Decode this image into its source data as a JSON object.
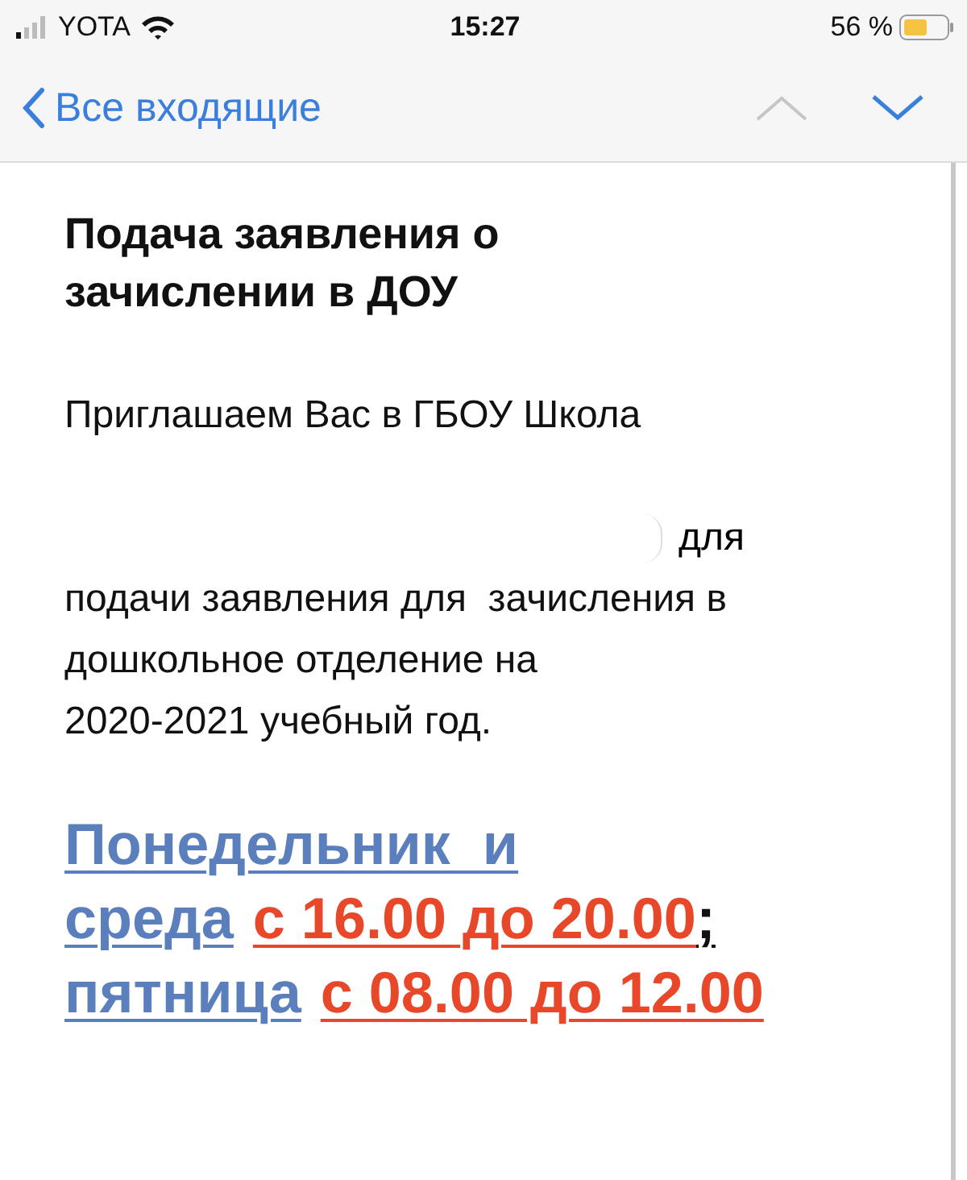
{
  "status_bar": {
    "carrier": "YOTA",
    "time": "15:27",
    "battery": "56 %"
  },
  "nav": {
    "back": "Все входящие"
  },
  "message": {
    "title": "Подача заявления о зачислении в ДОУ",
    "intro": "Приглашаем Вас в ГБОУ Школа",
    "after_redacted": "для",
    "body_lines": [
      "подачи заявления для  зачисления в",
      "дошкольное отделение на",
      "2020-2021 учебный год."
    ],
    "schedule_lines": [
      [
        {
          "text": "Понедельник  и",
          "color": "#5b7fbd"
        }
      ],
      [
        {
          "text": "среда",
          "color": "#5b7fbd"
        },
        {
          "text": "с 16.00 до 20.00",
          "color": "#e8472a"
        },
        {
          "text": ";",
          "color": "#111111",
          "kind": "punctuation"
        }
      ],
      [
        {
          "text": "пятница",
          "color": "#5b7fbd"
        },
        {
          "text": "с 08.00 до 12.00",
          "color": "#e8472a"
        }
      ]
    ]
  }
}
